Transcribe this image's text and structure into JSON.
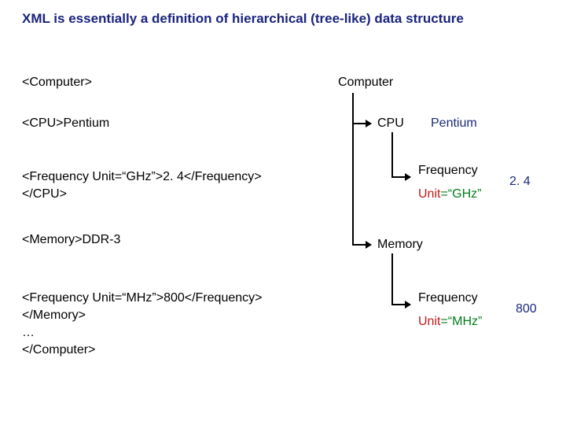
{
  "title": "XML is essentially a definition of hierarchical (tree-like) data structure",
  "code": {
    "computer_open": "<Computer>",
    "cpu_open": " <CPU>Pentium",
    "freq1": "   <Frequency Unit=“GHz”>2. 4</Frequency>",
    "cpu_close": " </CPU>",
    "mem_open": " <Memory>DDR-3",
    "freq2": "   <Frequency Unit=“MHz”>800</Frequency>",
    "mem_close": " </Memory>",
    "dots": " …",
    "computer_close": " </Computer>"
  },
  "tree": {
    "root": "Computer",
    "cpu": {
      "label": "CPU",
      "value": "Pentium",
      "freq": {
        "label": "Frequency",
        "unit_attr": "Unit",
        "unit_val": "=“GHz”",
        "value": "2. 4"
      }
    },
    "memory": {
      "label": "Memory",
      "freq": {
        "label": "Frequency",
        "unit_attr": "Unit",
        "unit_val": "=“MHz”",
        "value": "800"
      }
    }
  },
  "chart_data": {
    "type": "table",
    "title": "XML hierarchical structure example",
    "structure": {
      "Computer": {
        "CPU": {
          "text": "Pentium",
          "Frequency": {
            "Unit": "GHz",
            "value": 2.4
          }
        },
        "Memory": {
          "text": "DDR-3",
          "Frequency": {
            "Unit": "MHz",
            "value": 800
          }
        }
      }
    }
  }
}
